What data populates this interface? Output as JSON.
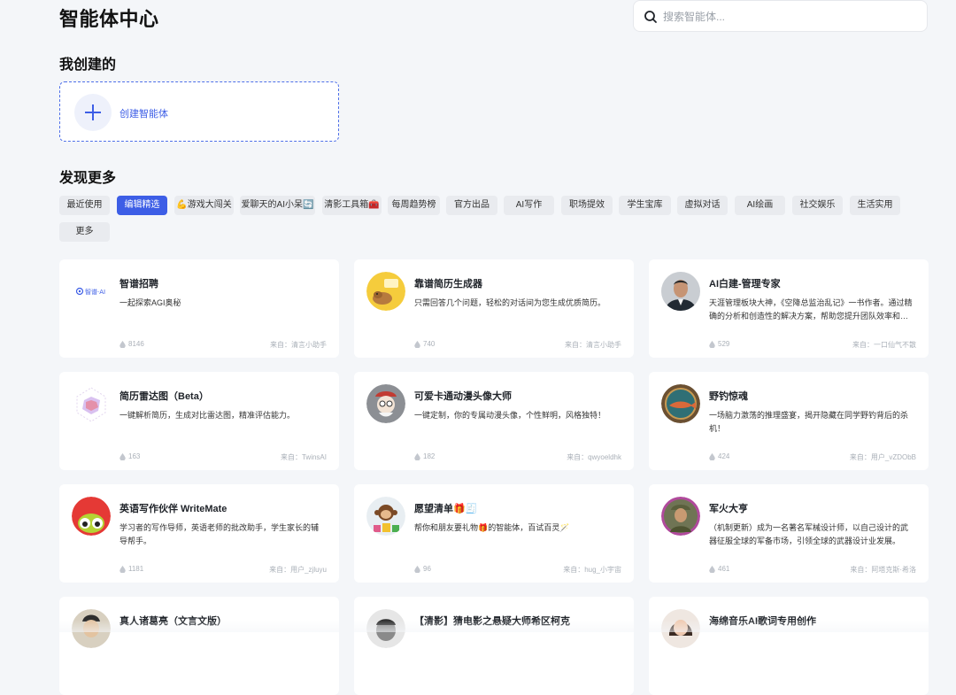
{
  "header": {
    "title": "智能体中心"
  },
  "search": {
    "placeholder": "搜索智能体..."
  },
  "mine": {
    "title": "我创建的",
    "create_label": "创建智能体"
  },
  "discover": {
    "title": "发现更多"
  },
  "tabs": [
    {
      "label": "最近使用"
    },
    {
      "label": "编辑精选",
      "active": true
    },
    {
      "label": "💪游戏大闯关"
    },
    {
      "label": "爱聊天的AI小呆🔄"
    },
    {
      "label": "清影工具箱🧰"
    },
    {
      "label": "每周趋势榜"
    },
    {
      "label": "官方出品"
    },
    {
      "label": "AI写作"
    },
    {
      "label": "职场提效"
    },
    {
      "label": "学生宝库"
    },
    {
      "label": "虚拟对话"
    },
    {
      "label": "AI绘画"
    },
    {
      "label": "社交娱乐"
    },
    {
      "label": "生活实用"
    },
    {
      "label": "更多"
    }
  ],
  "agents": [
    {
      "name": "智谱招聘",
      "desc": "一起探索AGI奥秘",
      "count": "8146",
      "source": "来自：清言小助手",
      "icon": "zhipu-logo-icon",
      "logo_text": "智谱·AI"
    },
    {
      "name": "靠谱简历生成器",
      "desc": "只需回答几个问题，轻松的对话间为您生成优质简历。",
      "count": "740",
      "source": "来自：清言小助手",
      "icon": "capybara-resume-icon"
    },
    {
      "name": "AI白建-管理专家",
      "desc": "天涯管理板块大神，《空降总监治乱记》一书作者。通过精确的分析和创造性的解决方案，帮助您提升团队效率和管理能力。",
      "count": "529",
      "source": "来自：一口仙气不散",
      "icon": "man-portrait-icon"
    },
    {
      "name": "简历雷达图（Beta）",
      "desc": "一键解析简历，生成对比雷达图，精准评估能力。",
      "count": "163",
      "source": "来自：TwinsAI",
      "icon": "radar-chart-icon"
    },
    {
      "name": "可爱卡通动漫头像大师",
      "desc": "一键定制，你的专属动漫头像，个性鲜明，风格独特！",
      "count": "182",
      "source": "来自：qwyoeldhk",
      "icon": "cartoon-avatar-icon"
    },
    {
      "name": "野钓惊魂",
      "desc": "一场脑力激荡的推理盛宴，揭开隐藏在同学野钓背后的杀机！",
      "count": "424",
      "source": "来自：用户_vZDObB",
      "icon": "fishing-badge-icon"
    },
    {
      "name": "英语写作伙伴 WriteMate",
      "desc": "学习者的写作导师，英语老师的批改助手，学生家长的辅导帮手。",
      "count": "1181",
      "source": "来自：用户_zjluyu",
      "icon": "frog-mascot-icon"
    },
    {
      "name": "愿望清单🎁🧾",
      "desc": "帮你和朋友要礼物🎁的智能体，百试百灵🪄",
      "count": "96",
      "source": "来自：hug_小宇宙",
      "icon": "monkey-gifts-icon"
    },
    {
      "name": "军火大亨",
      "desc": "（机制更新）成为一名著名军械设计师，以自己设计的武器征服全球的军备市场，引领全球的武器设计业发展。",
      "count": "461",
      "source": "来自：阿塔克斯·希洛",
      "icon": "soldier-portrait-icon"
    },
    {
      "name": "真人诸葛亮（文言文版）",
      "desc": "",
      "count": "",
      "source": "",
      "icon": "zhuge-portrait-icon"
    },
    {
      "name": "【清影】猜电影之悬疑大师希区柯克",
      "desc": "",
      "count": "",
      "source": "",
      "icon": "hitchcock-portrait-icon"
    },
    {
      "name": "海绵音乐AI歌词专用创作",
      "desc": "",
      "count": "",
      "source": "",
      "icon": "woman-portrait-icon"
    }
  ]
}
